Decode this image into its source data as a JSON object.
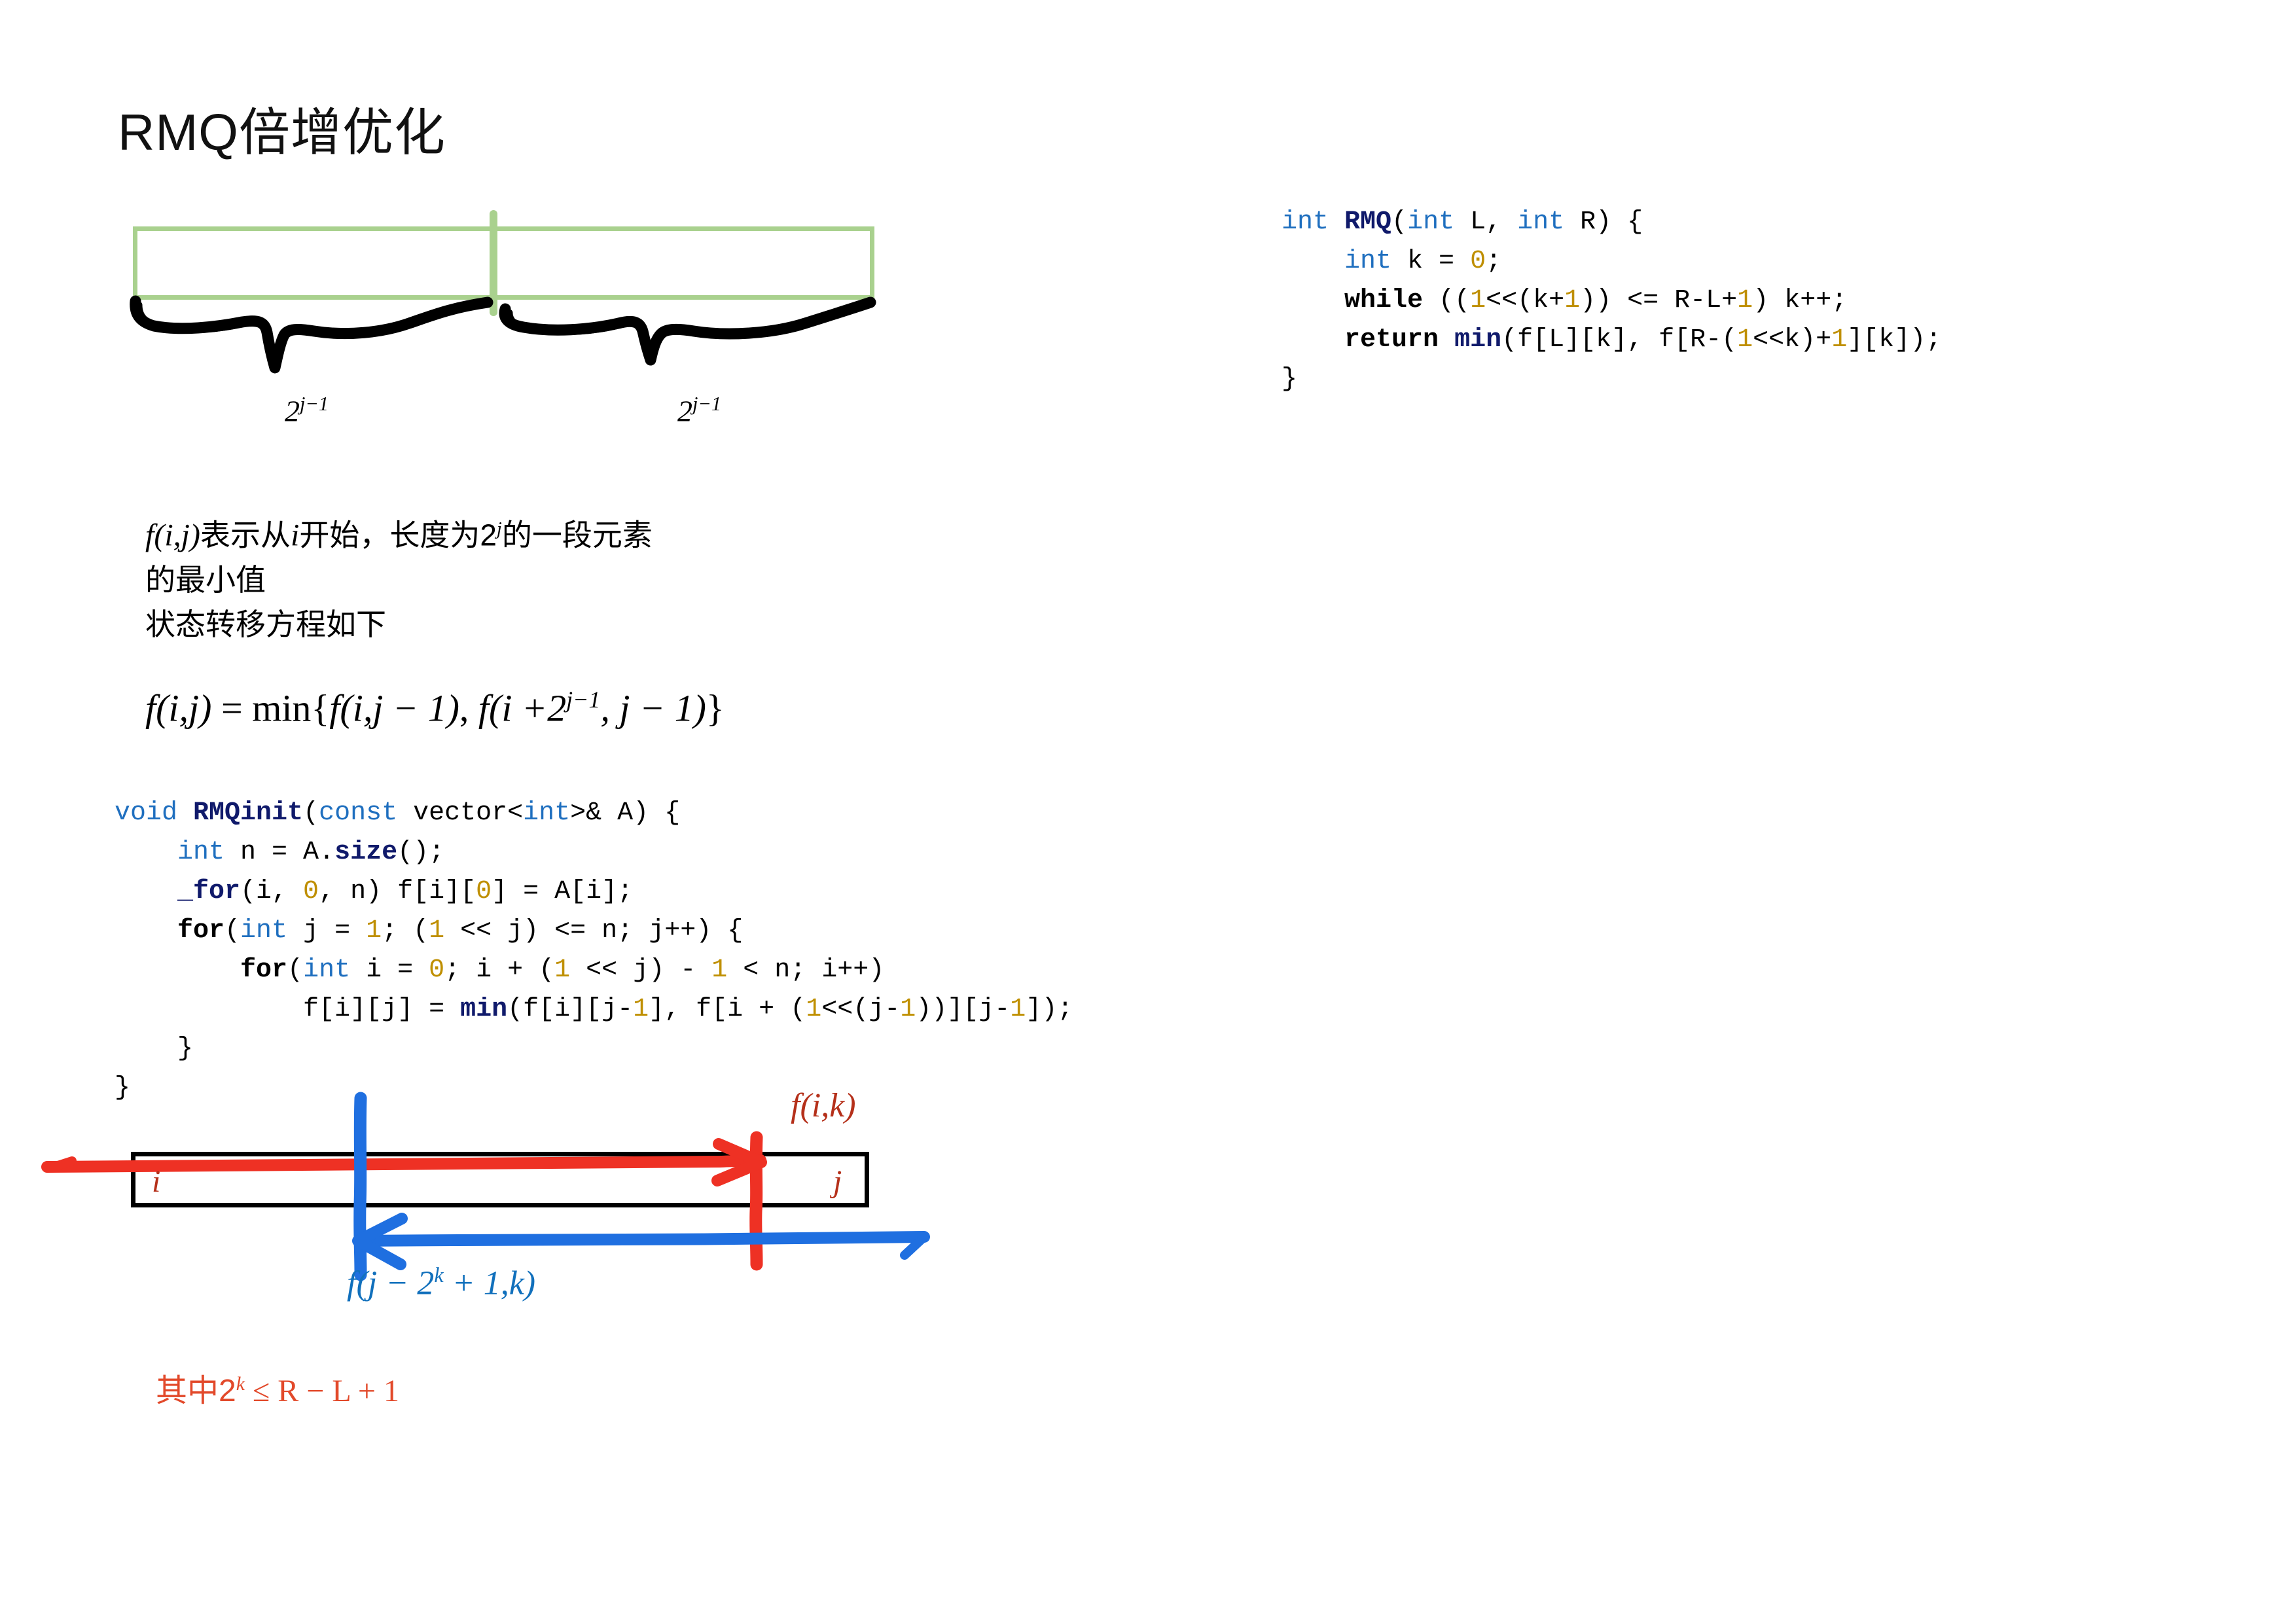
{
  "slide": {
    "title": "RMQ倍增优化"
  },
  "top_diagram": {
    "box_color": "#a9d18e",
    "divider_color": "#a9d18e",
    "brace_color": "#000000",
    "left_label": "2",
    "left_label_sup": "j−1",
    "right_label": "2",
    "right_label_sup": "j−1"
  },
  "code_rmq": {
    "lines": [
      "int RMQ(int L, int R) {",
      "    int k = 0;",
      "    while ((1<<(k+1)) <= R-L+1) k++;",
      "    return min(f[L][k], f[R-(1<<k)+1][k]);",
      "}"
    ],
    "l1_kw1": "int",
    "l1_fn": "RMQ",
    "l1_open": "(",
    "l1_kw2": "int",
    "l1_p1": " L, ",
    "l1_kw3": "int",
    "l1_p2": " R) {",
    "l2_kw": "int",
    "l2_mid": " k = ",
    "l2_num": "0",
    "l2_end": ";",
    "l3_kw": "while",
    "l3_a": " ((",
    "l3_n1": "1",
    "l3_b": "<<(k+",
    "l3_n2": "1",
    "l3_c": ")) <= R-L+",
    "l3_n3": "1",
    "l3_d": ") k++;",
    "l4_kw": "return",
    "l4_fn": "min",
    "l4_a": "(f[L][k], f[R-(",
    "l4_n1": "1",
    "l4_b": "<<k)+",
    "l4_n2": "1",
    "l4_c": "][k]);",
    "l5": "}"
  },
  "code_init": {
    "lines": [
      "void RMQinit(const vector<int>& A) {",
      "    int n = A.size();",
      "    _for(i, 0, n) f[i][0] = A[i];",
      "    for(int j = 1; (1 << j) <= n; j++) {",
      "        for(int i = 0; i + (1 << j) - 1 < n; i++)",
      "            f[i][j] = min(f[i][j-1], f[i + (1<<(j-1))][j-1]);",
      "    }",
      "}"
    ],
    "l1_kw1": "void",
    "l1_fn": "RMQinit",
    "l1_a": "(",
    "l1_kw2": "const",
    "l1_b": " vector<",
    "l1_kw3": "int",
    "l1_c": ">& A) {",
    "l2_kw": "int",
    "l2_a": " n = A.",
    "l2_fn": "size",
    "l2_b": "();",
    "l3_fn": "_for",
    "l3_a": "(i, ",
    "l3_n1": "0",
    "l3_b": ", n) f[i][",
    "l3_n2": "0",
    "l3_c": "] = A[i];",
    "l4_kw": "for",
    "l4_a": "(",
    "l4_kw2": "int",
    "l4_b": " j = ",
    "l4_n1": "1",
    "l4_c": "; (",
    "l4_n2": "1",
    "l4_d": " << j) <= n; j++) {",
    "l5_kw": "for",
    "l5_a": "(",
    "l5_kw2": "int",
    "l5_b": " i = ",
    "l5_n1": "0",
    "l5_c": "; i + (",
    "l5_n2": "1",
    "l5_d": " << j) - ",
    "l5_n3": "1",
    "l5_e": " < n; i++)",
    "l6_a": "f[i][j] = ",
    "l6_fn": "min",
    "l6_b": "(f[i][j-",
    "l6_n1": "1",
    "l6_c": "], f[i + (",
    "l6_n2": "1",
    "l6_d": "<<(j-",
    "l6_n3": "1",
    "l6_e": "))][j-",
    "l6_n4": "1",
    "l6_f": "]);",
    "l7": "}",
    "l8": "}"
  },
  "description": {
    "line1_a": "f(i,j)",
    "line1_b": "表示从",
    "line1_c": "i",
    "line1_d": "开始，长度为2",
    "line1_sup": "j",
    "line1_e": "的一段元素",
    "line2": "的最小值",
    "line3": "状态转移方程如下"
  },
  "formula": {
    "text": "f(i,j) = min{f(i,j − 1), f(i + 2^{j−1}, j − 1)}",
    "lhs": "f(i,j)",
    "eq": " = ",
    "min": "min",
    "open": "{",
    "t1": "f(i,j − 1)",
    "comma": ", ",
    "t2a": "f(i +2",
    "t2sup": "j−1",
    "t2b": ", j − 1)",
    "close": "}"
  },
  "bottom_diagram": {
    "box_border_color": "#000000",
    "left_index": "i",
    "right_index": "j",
    "red_color": "#ee3124",
    "blue_color": "#1f6fe0",
    "red_label_a": "f(i,k)",
    "blue_label_a": "f(j − 2",
    "blue_label_sup": "k",
    "blue_label_b": " + 1,k)"
  },
  "footer": {
    "prefix": "其中2",
    "sup": "k",
    "rest": " ≤ R − L + 1",
    "color": "#e2492a"
  }
}
